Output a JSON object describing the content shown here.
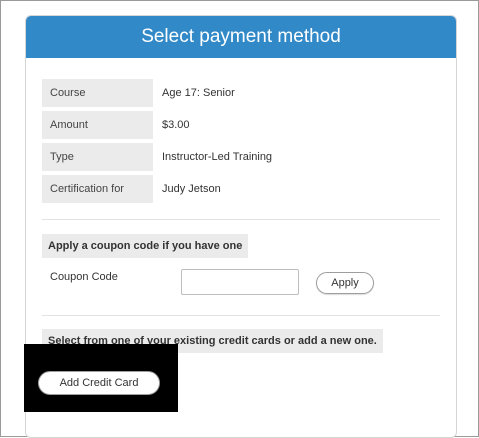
{
  "header": {
    "title": "Select payment method"
  },
  "details": [
    {
      "label": "Course",
      "value": "Age 17: Senior"
    },
    {
      "label": "Amount",
      "value": "$3.00"
    },
    {
      "label": "Type",
      "value": "Instructor-Led Training"
    },
    {
      "label": "Certification for",
      "value": "Judy Jetson"
    }
  ],
  "coupon": {
    "section_title": "Apply a coupon code if you have one",
    "label": "Coupon Code",
    "value": "",
    "apply_label": "Apply"
  },
  "credit_cards": {
    "section_title": "Select from one of your existing credit cards or add a new one.",
    "add_label": "Add Credit Card"
  },
  "colors": {
    "header_bg": "#3289c8",
    "label_bg": "#ebebeb"
  }
}
